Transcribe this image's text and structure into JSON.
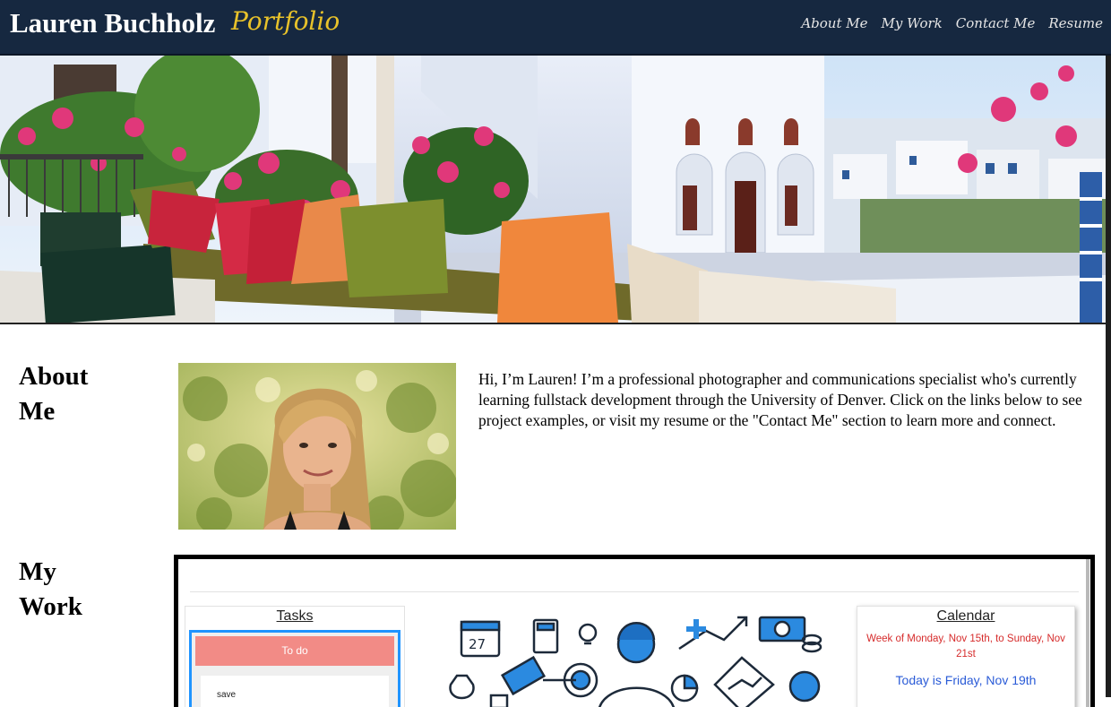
{
  "header": {
    "name": "Lauren Buchholz",
    "subtitle": "Portfolio",
    "nav": [
      "About Me",
      "My Work",
      "Contact Me",
      "Resume"
    ]
  },
  "about": {
    "heading_line1": "About",
    "heading_line2": "Me",
    "text": "Hi, I’m Lauren! I’m a professional photographer and communications specialist who's currently learning fullstack development through the University of Denver. Click on the links below to see project examples, or visit my resume or the \"Contact Me\" section to learn more and connect."
  },
  "work": {
    "heading_line1": "My",
    "heading_line2": "Work",
    "preview": {
      "tasks_title": "Tasks",
      "todo_label": "To do",
      "task_text": "save",
      "calendar_number": "27",
      "calendar_title": "Calendar",
      "calendar_week": "Week of Monday, Nov 15th, to Sunday, Nov 21st",
      "calendar_today": "Today is Friday, Nov 19th"
    }
  },
  "colors": {
    "header_bg": "#162840",
    "subtitle_gold": "#e8c22a",
    "task_blue": "#1f94ff",
    "todo_red": "#f28b86",
    "week_red": "#d62b2b",
    "today_blue": "#2a5bd7"
  }
}
